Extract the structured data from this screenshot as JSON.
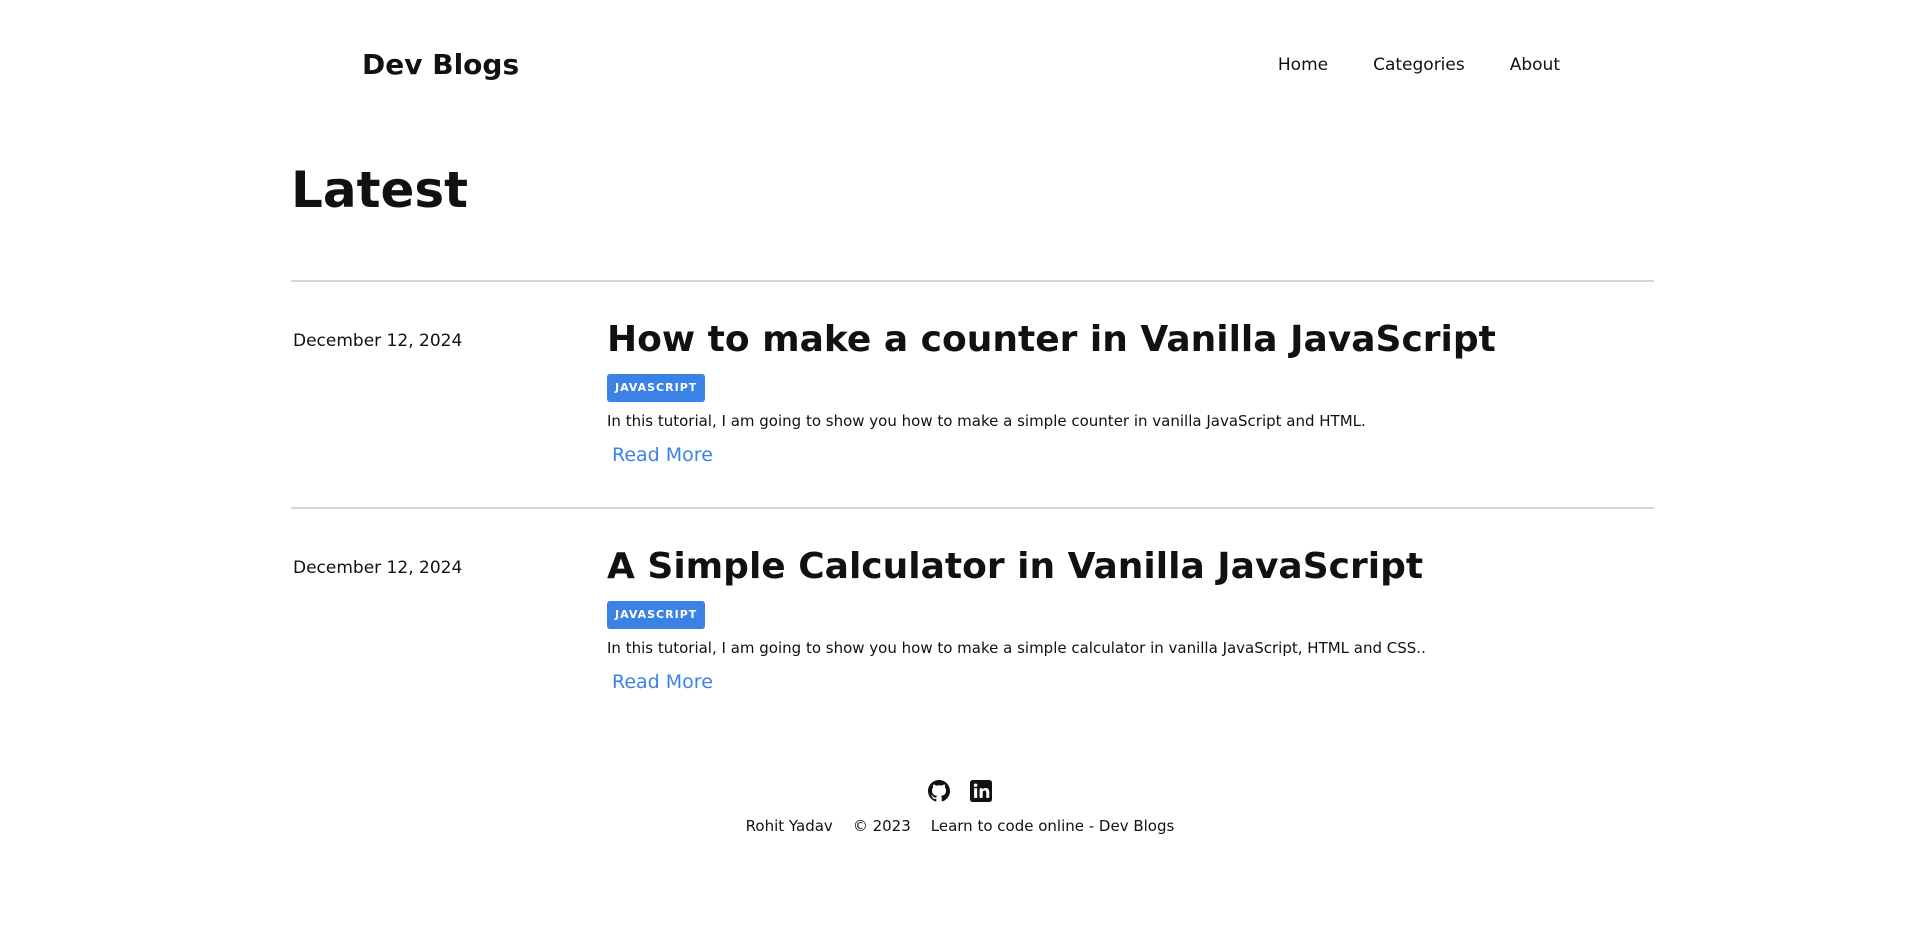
{
  "header": {
    "logo": "Dev Blogs",
    "nav": [
      "Home",
      "Categories",
      "About"
    ]
  },
  "main": {
    "heading": "Latest",
    "posts": [
      {
        "date": "December 12, 2024",
        "title": "How to make a counter in Vanilla JavaScript",
        "tag": "JAVASCRIPT",
        "excerpt": "In this tutorial, I am going to show you how to make a simple counter in vanilla JavaScript and HTML.",
        "read_more": "Read More"
      },
      {
        "date": "December 12, 2024",
        "title": "A Simple Calculator in Vanilla JavaScript",
        "tag": "JAVASCRIPT",
        "excerpt": "In this tutorial, I am going to show you how to make a simple calculator in vanilla JavaScript, HTML and CSS..",
        "read_more": "Read More"
      }
    ]
  },
  "footer": {
    "icons": [
      "github-icon",
      "linkedin-icon"
    ],
    "author": "Rohit Yadav",
    "copyright": "© 2023",
    "tagline": "Learn to code online - Dev Blogs"
  },
  "colors": {
    "accent": "#3b82e6",
    "text": "#111111",
    "divider": "#d6d6d6"
  }
}
